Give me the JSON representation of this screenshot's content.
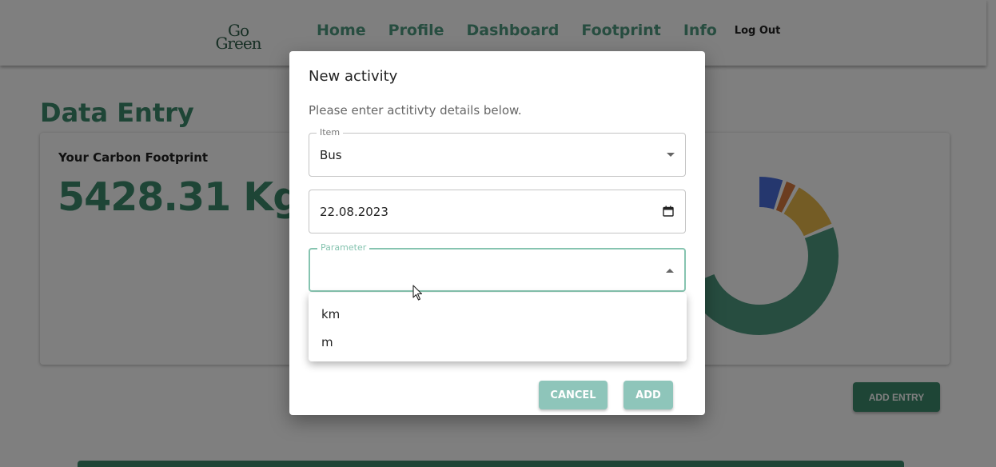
{
  "header": {
    "logo_line1": "Go",
    "logo_line2": "Green",
    "nav": [
      "Home",
      "Profile",
      "Dashboard",
      "Footprint",
      "Info"
    ],
    "logout": "Log Out"
  },
  "page": {
    "title": "Data Entry",
    "footprint_label": "Your Carbon Footprint",
    "footprint_value": "5428.31 Kg",
    "add_entry_label": "ADD ENTRY"
  },
  "dialog": {
    "title": "New activity",
    "description": "Please enter actitivty details below.",
    "item_label": "Item",
    "item_value": "Bus",
    "date_value": "22.08.2023",
    "parameter_label": "Parameter",
    "parameter_value": "",
    "parameter_options": [
      "km",
      "m"
    ],
    "cancel_label": "CANCEL",
    "add_label": "ADD"
  },
  "colors": {
    "brand_green": "#3c8a6c",
    "nav_green": "#4f9a80",
    "focus_teal": "#86c4b0",
    "button_teal": "#8ec5ba",
    "donut_blue": "#4a6fdc",
    "donut_green": "#4f9a80",
    "donut_yellow": "#e8b84a",
    "donut_orange": "#d87a3f"
  },
  "icons": {
    "calendar": "calendar-icon",
    "dropdown": "chevron-down-icon",
    "dropup": "chevron-up-icon",
    "cursor": "mouse-pointer-icon"
  }
}
